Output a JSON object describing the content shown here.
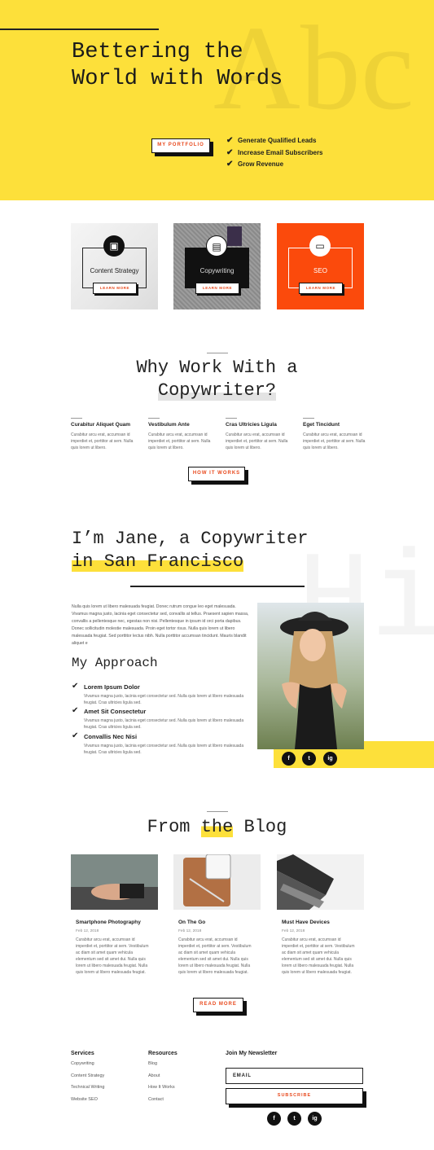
{
  "hero": {
    "watermark": "Abc",
    "title": "Bettering the World with Words",
    "button": "MY PORTFOLIO",
    "checks": [
      "Generate Qualified Leads",
      "Increase Email Subscribers",
      "Grow Revenue"
    ]
  },
  "services": [
    {
      "label": "Content Strategy",
      "button": "LEARN MORE",
      "icon": "briefcase-icon"
    },
    {
      "label": "Copywriting",
      "button": "LEARN MORE",
      "icon": "document-icon"
    },
    {
      "label": "SEO",
      "button": "LEARN MORE",
      "icon": "monitor-icon"
    }
  ],
  "why": {
    "title_line1": "Why Work With a",
    "title_line2": "Copywriter?",
    "features": [
      {
        "title": "Curabitur Aliquet Quam",
        "text": "Curabitur arcu erat, accumsan id imperdiet et, porttitor at sem. Nulla quis lorem ut libero."
      },
      {
        "title": "Vestibulum Ante",
        "text": "Curabitur arcu erat, accumsan id imperdiet et, porttitor at sem. Nulla quis lorem ut libero."
      },
      {
        "title": "Cras Ultricies Ligula",
        "text": "Curabitur arcu erat, accumsan id imperdiet et, porttitor at sem. Nulla quis lorem ut libero."
      },
      {
        "title": "Eget Tincidunt",
        "text": "Curabitur arcu erat, accumsan id imperdiet et, porttitor at sem. Nulla quis lorem ut libero."
      }
    ],
    "button": "HOW IT WORKS"
  },
  "about": {
    "watermark": "Hi",
    "title_line1": "I’m Jane, a Copywriter",
    "title_line2": "in San Francisco",
    "text": "Nulla quis lorem ut libero malesuada feugiat. Donec rutrum congue leo eget malesuada. Vivamus magna justo, lacinia eget consectetur sed, convallis at tellus. Praesent sapien massa, convallis a pellentesque nec, egestas non nisi. Pellentesque in ipsum id orci porta dapibus. Donec sollicitudin molestie malesuada. Proin eget tortor risus. Nulla quis lorem ut libero malesuada feugiat. Sed porttitor lectus nibh. Nulla porttitor accumsan tincidunt. Mauris blandit aliquet e",
    "approach_title": "My Approach",
    "approach": [
      {
        "title": "Lorem Ipsum Dolor",
        "text": "Vivamus magna justo, lacinia eget consectetur sed. Nulla quis lorem ut libero malesuada feugiat. Cras ultricies ligula sed."
      },
      {
        "title": "Amet Sit Consectetur",
        "text": "Vivamus magna justo, lacinia eget consectetur sed. Nulla quis lorem ut libero malesuada feugiat. Cras ultricies ligula sed."
      },
      {
        "title": "Convallis Nec Nisi",
        "text": "Vivamus magna justo, lacinia eget consectetur sed. Nulla quis lorem ut libero malesuada feugiat. Cras ultricies ligula sed."
      }
    ],
    "socials": [
      "f",
      "t",
      "ig"
    ]
  },
  "blog": {
    "title_pre": "From",
    "title_hl": "the",
    "title_post": "Blog",
    "posts": [
      {
        "title": "Smartphone Photography",
        "date": "Feb 12, 2018",
        "text": "Curabitur arcu erat, accumsan id imperdiet et, porttitor at sem. Vestibulum ac diam sit amet quam vehicula elementum sed sit amet dui. Nulla quis lorem ut libero malesuada feugiat. Nulla quis lorem ut libero malesuada feugiat."
      },
      {
        "title": "On The Go",
        "date": "Feb 12, 2018",
        "text": "Curabitur arcu erat, accumsan id imperdiet et, porttitor at sem. Vestibulum ac diam sit amet quam vehicula elementum sed sit amet dui. Nulla quis lorem ut libero malesuada feugiat. Nulla quis lorem ut libero malesuada feugiat."
      },
      {
        "title": "Must Have Devices",
        "date": "Feb 12, 2018",
        "text": "Curabitur arcu erat, accumsan id imperdiet et, porttitor at sem. Vestibulum ac diam sit amet quam vehicula elementum sed sit amet dui. Nulla quis lorem ut libero malesuada feugiat. Nulla quis lorem ut libero malesuada feugiat."
      }
    ],
    "button": "READ MORE"
  },
  "footer": {
    "services_title": "Services",
    "services": [
      "Copywriting",
      "Content Strategy",
      "Technical Writing",
      "Website SEO"
    ],
    "resources_title": "Resources",
    "resources": [
      "Blog",
      "About",
      "How It Works",
      "Contact"
    ],
    "newsletter_title": "Join My Newsletter",
    "email_placeholder": "EMAIL",
    "subscribe": "SUBSCRIBE",
    "socials": [
      "f",
      "t",
      "ig"
    ]
  },
  "colors": {
    "accent_yellow": "#fde03a",
    "accent_orange": "#fb4a0c",
    "button_text": "#e8491d",
    "dark": "#111111"
  }
}
